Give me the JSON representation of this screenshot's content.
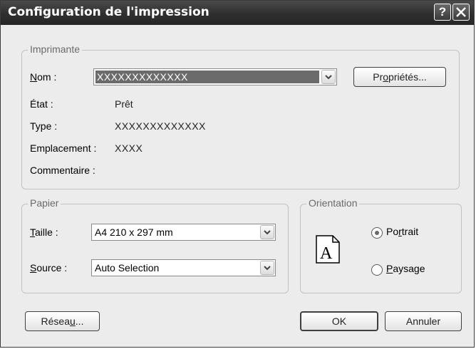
{
  "window": {
    "title": "Configuration de l'impression",
    "help_label": "?",
    "close_label": "X"
  },
  "printer": {
    "group_label": "Imprimante",
    "name_label_ul": "N",
    "name_label_rest": "om :",
    "name_value": "XXXXXXXXXXXXX",
    "properties_pre": "Pr",
    "properties_ul": "o",
    "properties_post": "priétés...",
    "status_label": "État :",
    "status_value": "Prêt",
    "type_label": "Type :",
    "type_value": "XXXXXXXXXXXXX",
    "location_label": "Emplacement :",
    "location_value": "XXXX",
    "comment_label": "Commentaire :"
  },
  "paper": {
    "group_label": "Papier",
    "size_label_ul": "T",
    "size_label_rest": "aille :",
    "size_value": "A4 210 x 297 mm",
    "source_label_ul": "S",
    "source_label_rest": "ource :",
    "source_value": "Auto Selection"
  },
  "orientation": {
    "group_label": "Orientation",
    "page_letter": "A",
    "portrait_pre": "Po",
    "portrait_ul": "r",
    "portrait_post": "trait",
    "landscape_ul": "P",
    "landscape_post": "aysage",
    "selected": "portrait"
  },
  "footer": {
    "network_pre": "Résea",
    "network_ul": "u",
    "network_post": "...",
    "ok_label": "OK",
    "cancel_label": "Annuler"
  }
}
